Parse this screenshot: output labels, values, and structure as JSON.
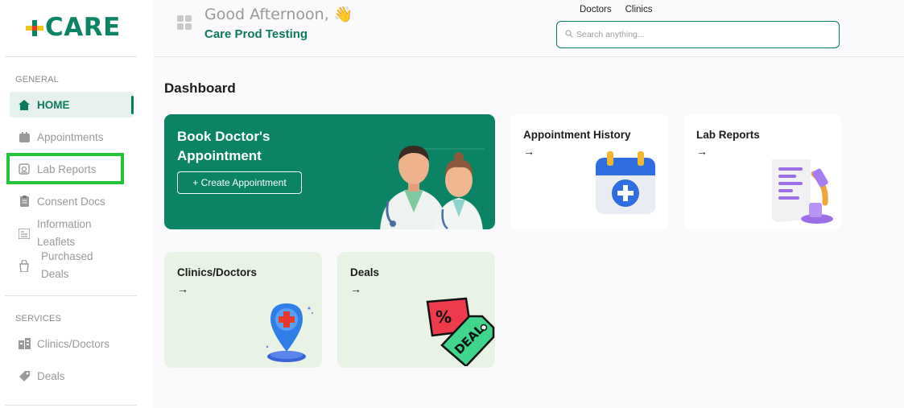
{
  "brand": {
    "name": "CARE"
  },
  "sidebar": {
    "sections": [
      {
        "label": "GENERAL",
        "items": [
          {
            "label": "HOME",
            "icon": "home-icon",
            "active": true
          },
          {
            "label": "Appointments",
            "icon": "calendar-icon"
          },
          {
            "label": "Lab Reports",
            "icon": "lab-report-icon",
            "highlighted": true
          },
          {
            "label": "Consent Docs",
            "icon": "clipboard-icon"
          },
          {
            "label": "Information Leaflets",
            "line1": "Information",
            "line2": "Leaflets",
            "icon": "leaflet-icon"
          },
          {
            "label": "Purchased Deals",
            "line1": "Purchased",
            "line2": "Deals",
            "icon": "purchased-deals-icon"
          }
        ]
      },
      {
        "label": "SERVICES",
        "items": [
          {
            "label": "Clinics/Doctors",
            "icon": "building-icon"
          },
          {
            "label": "Deals",
            "icon": "tag-icon"
          }
        ]
      }
    ]
  },
  "header": {
    "greeting": "Good Afternoon,",
    "greeting_emoji": "👋",
    "org_name": "Care Prod Testing",
    "links": [
      "Doctors",
      "Clinics"
    ],
    "search_placeholder": "Search anything..."
  },
  "main": {
    "title": "Dashboard",
    "cards": {
      "book": {
        "title_line1": "Book Doctor's",
        "title_line2": "Appointment",
        "button_label": "+  Create Appointment"
      },
      "history": {
        "title": "Appointment History",
        "arrow": "→"
      },
      "lab": {
        "title": "Lab Reports",
        "arrow": "→"
      },
      "clinics": {
        "title": "Clinics/Doctors",
        "arrow": "→"
      },
      "deals": {
        "title": "Deals",
        "arrow": "→",
        "illustration_text": "DEAL"
      }
    }
  },
  "colors": {
    "primary": "#0b8466",
    "highlight": "#22c43a",
    "card_green": "#e9f3e5"
  }
}
